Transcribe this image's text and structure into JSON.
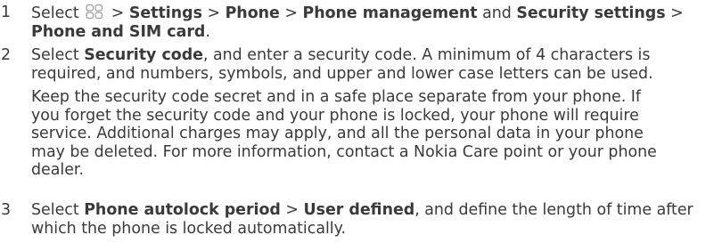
{
  "steps": [
    {
      "number": "1",
      "line1": {
        "t1": "Select ",
        "t2": " > ",
        "b1": "Settings",
        "t3": " > ",
        "b2": "Phone",
        "t4": " > ",
        "b3": "Phone management",
        "t5": " and ",
        "b4": "Security settings",
        "t6": " >"
      },
      "line2": {
        "b1": "Phone and SIM card",
        "t1": "."
      },
      "icon": "apps-grid-icon"
    },
    {
      "number": "2",
      "para1": {
        "l1_t1": "Select ",
        "l1_b1": "Security code",
        "l1_t2": ", and enter a security code. A minimum of 4 characters is",
        "l2": "required, and numbers, symbols, and upper and lower case letters can be used."
      },
      "para2": [
        "Keep the security code secret and in a safe place separate from your phone. If",
        "you forget the security code and your phone is locked, your phone will require",
        "service. Additional charges may apply, and all the personal data in your phone",
        "may be deleted. For more information, contact a Nokia Care point or your phone",
        "dealer."
      ]
    },
    {
      "number": "3",
      "line1": {
        "t1": "Select ",
        "b1": "Phone autolock period",
        "t2": " > ",
        "b2": "User defined",
        "t3": ", and define the length of time after"
      },
      "line2": "which the phone is locked automatically."
    }
  ]
}
